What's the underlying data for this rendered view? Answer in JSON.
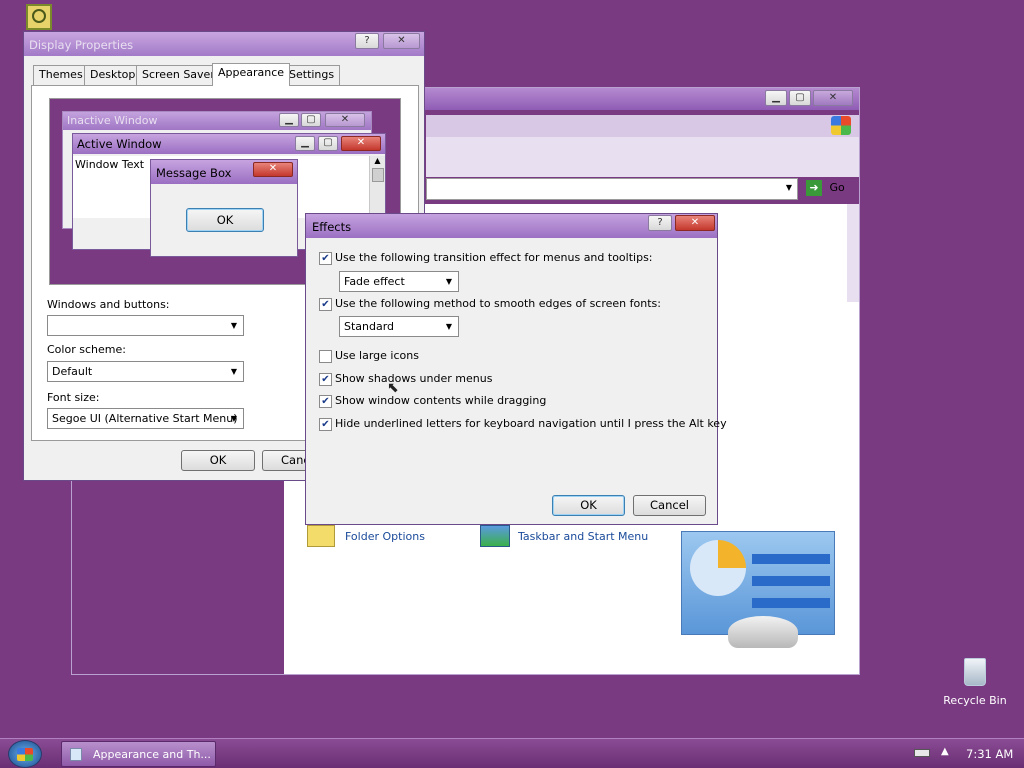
{
  "colors": {
    "desktop": "#7a3a82",
    "accent": "#9a66c0"
  },
  "desktop": {
    "top_icon": "clock-icon",
    "recycle_bin_label": "Recycle Bin"
  },
  "back_window": {
    "go_label": "Go",
    "folder_options": "Folder Options",
    "taskbar_start_menu": "Taskbar and Start Menu"
  },
  "display_properties": {
    "title": "Display Properties",
    "tabs": [
      "Themes",
      "Desktop",
      "Screen Saver",
      "Appearance",
      "Settings"
    ],
    "preview": {
      "inactive_window": "Inactive Window",
      "active_window": "Active Window",
      "window_text": "Window Text",
      "message_box": "Message Box",
      "ok": "OK"
    },
    "windows_buttons_label": "Windows and buttons:",
    "windows_buttons_value": "",
    "color_scheme_label": "Color scheme:",
    "color_scheme_value": "Default",
    "font_size_label": "Font size:",
    "font_size_value": "Segoe UI (Alternative Start Menu)",
    "ok": "OK",
    "cancel": "Canc"
  },
  "effects": {
    "title": "Effects",
    "transition_label": "Use the following transition effect for menus and tooltips:",
    "transition_value": "Fade effect",
    "smooth_label": "Use the following method to smooth edges of screen fonts:",
    "smooth_value": "Standard",
    "large_icons": "Use large icons",
    "shadows": "Show shadows under menus",
    "drag_contents": "Show window contents while dragging",
    "hide_underline": "Hide underlined letters for keyboard navigation until I press the Alt key",
    "ok": "OK",
    "cancel": "Cancel"
  },
  "taskbar": {
    "task_label": "Appearance and Th...",
    "time": "7:31 AM"
  }
}
